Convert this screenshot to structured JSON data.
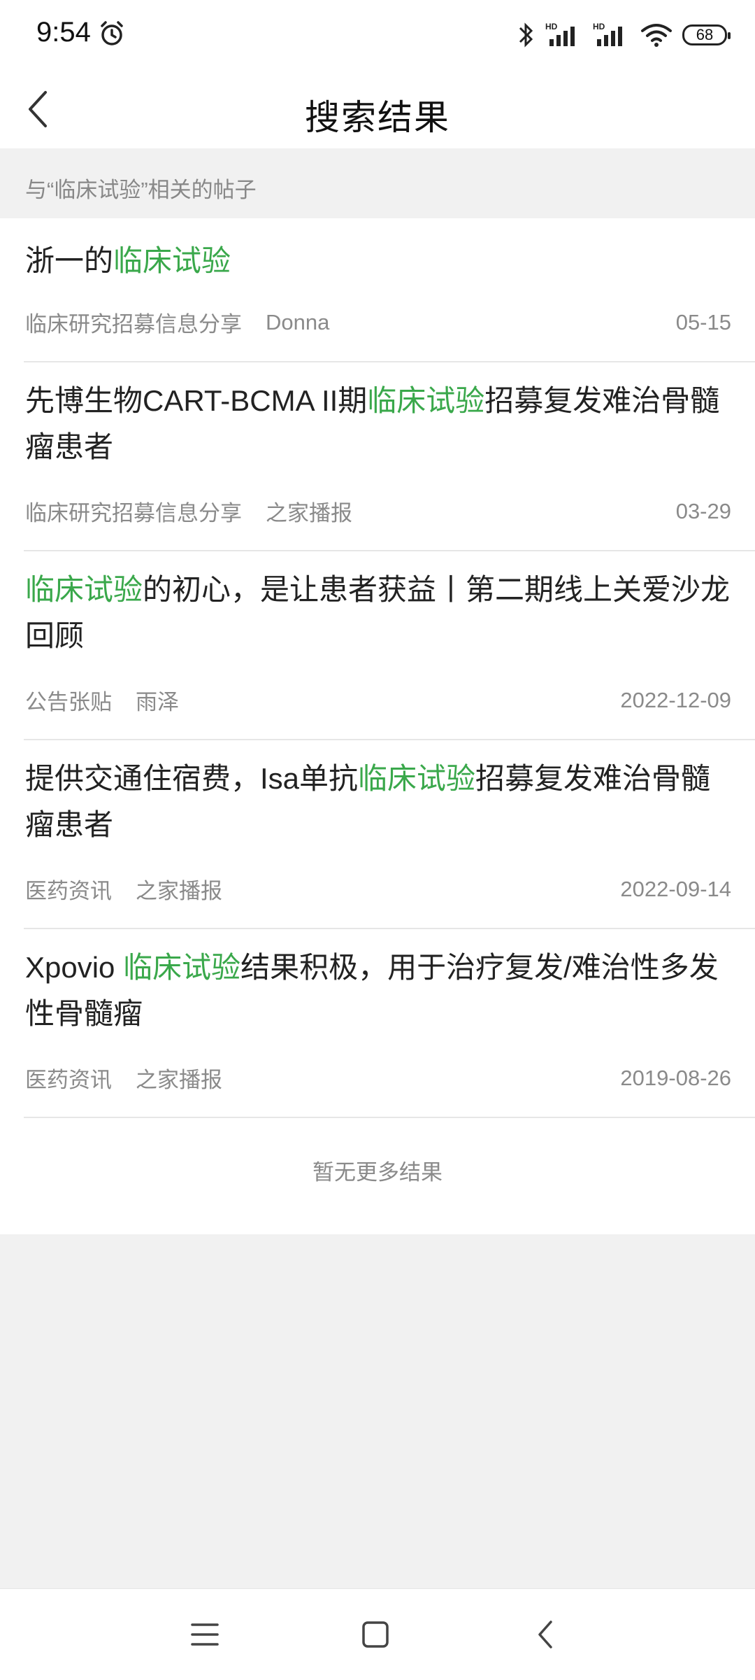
{
  "status": {
    "time": "9:54",
    "battery": "68",
    "icons": [
      "alarm-icon",
      "bluetooth-icon",
      "signal-hd-icon",
      "signal-hd-icon",
      "wifi-icon",
      "battery-icon"
    ]
  },
  "nav": {
    "title": "搜索结果",
    "back_icon": "chevron-left-icon"
  },
  "section": {
    "header": "与“临床试验”相关的帖子"
  },
  "results": [
    {
      "title_before": "浙一的",
      "highlight": "临床试验",
      "title_after": "",
      "category": "临床研究招募信息分享",
      "author": "Donna",
      "date": "05-15"
    },
    {
      "title_before": "先博生物CART-BCMA II期",
      "highlight": "临床试验",
      "title_after": "招募复发难治骨髓瘤患者",
      "category": "临床研究招募信息分享",
      "author": "之家播报",
      "date": "03-29"
    },
    {
      "title_before": "",
      "highlight": "临床试验",
      "title_after": "的初心，是让患者获益丨第二期线上关爱沙龙回顾",
      "category": "公告张贴",
      "author": "雨泽",
      "date": "2022-12-09"
    },
    {
      "title_before": "提供交通住宿费，Isa单抗",
      "highlight": "临床试验",
      "title_after": "招募复发难治骨髓瘤患者",
      "category": "医药资讯",
      "author": "之家播报",
      "date": "2022-09-14"
    },
    {
      "title_before": "Xpovio ",
      "highlight": "临床试验",
      "title_after": "结果积极，用于治疗复发/难治性多发性骨髓瘤",
      "category": "医药资讯",
      "author": "之家播报",
      "date": "2019-08-26"
    }
  ],
  "footer": {
    "no_more": "暂无更多结果"
  },
  "gesture_nav": {
    "icons": [
      "menu-icon",
      "home-icon",
      "back-icon"
    ]
  },
  "colors": {
    "highlight": "#3aa84b",
    "meta_text": "#8a8a8a",
    "background": "#f1f1f1"
  }
}
